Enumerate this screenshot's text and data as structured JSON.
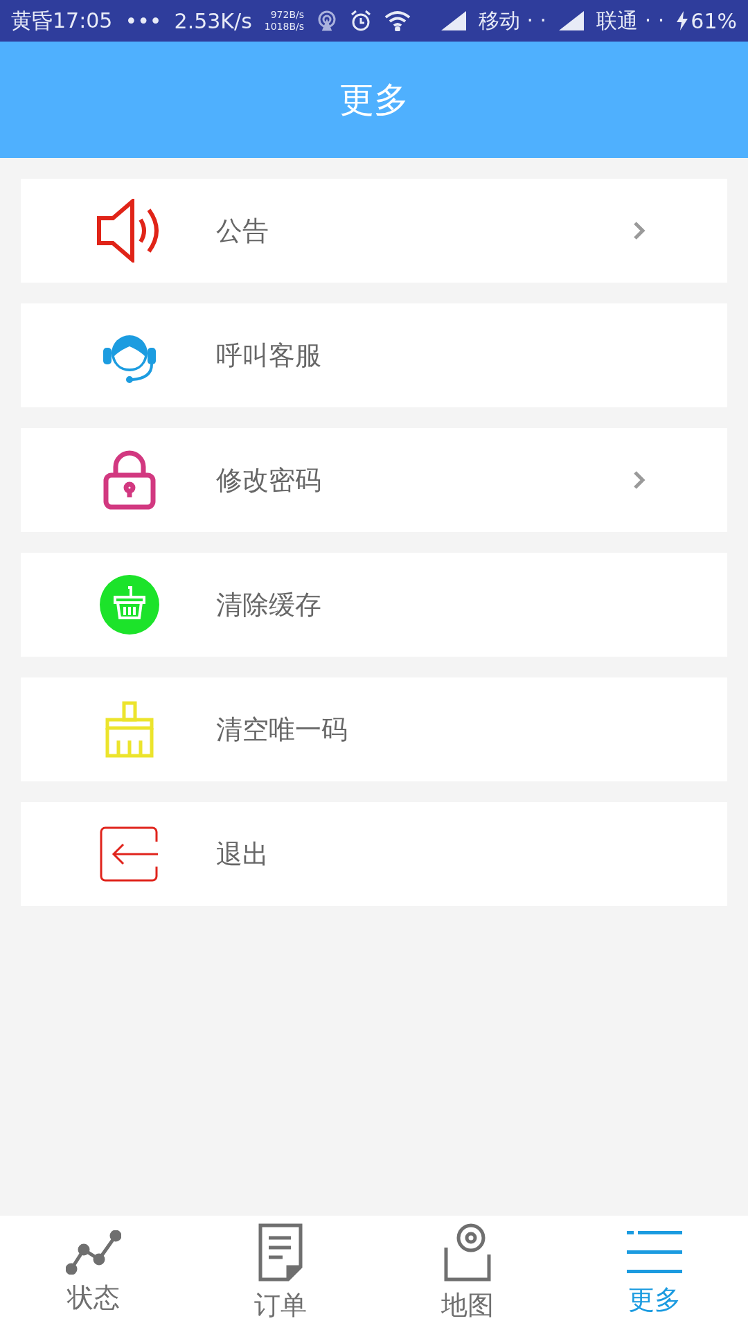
{
  "status_bar": {
    "time": "黄昏17:05",
    "dots": "•••",
    "speed": "2.53K/s",
    "up": "972B/s",
    "down": "1018B/s",
    "carrier_1": "移动 · ·",
    "carrier_2": "联通 · ·",
    "battery": "61%"
  },
  "header": {
    "title": "更多"
  },
  "menu": [
    {
      "kind": "speaker",
      "label": "公告",
      "arrow": true
    },
    {
      "kind": "headset",
      "label": "呼叫客服",
      "arrow": false
    },
    {
      "kind": "lock",
      "label": "修改密码",
      "arrow": true
    },
    {
      "kind": "basket",
      "label": "清除缓存",
      "arrow": false
    },
    {
      "kind": "brush",
      "label": "清空唯一码",
      "arrow": false
    },
    {
      "kind": "exit",
      "label": "退出",
      "arrow": false
    }
  ],
  "tabs": [
    {
      "kind": "chart",
      "label": "状态",
      "selected": false
    },
    {
      "kind": "doc",
      "label": "订单",
      "selected": false
    },
    {
      "kind": "pin",
      "label": "地图",
      "selected": false
    },
    {
      "kind": "list",
      "label": "更多",
      "selected": true
    }
  ]
}
